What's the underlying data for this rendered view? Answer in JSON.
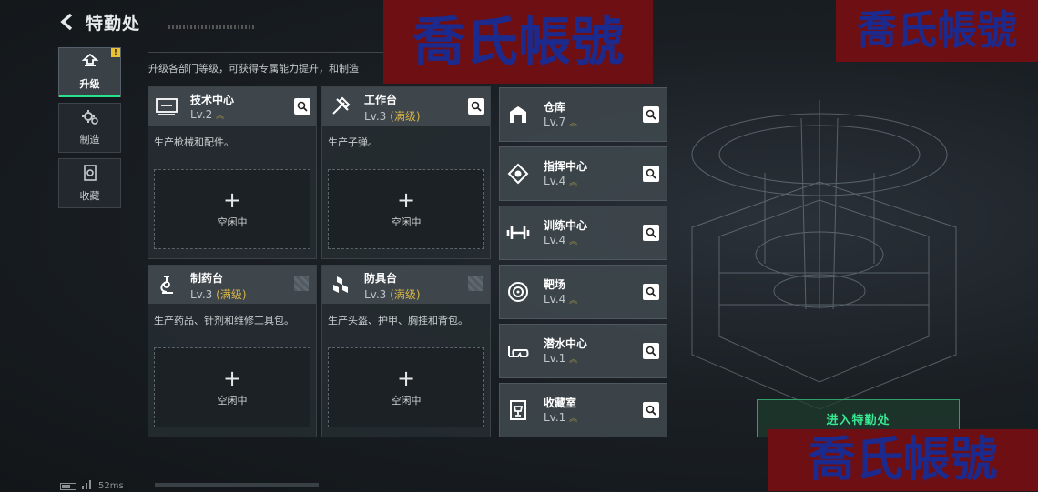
{
  "header": {
    "title": "特勤处"
  },
  "description": "升级各部门等级，可获得专属能力提升，和制造",
  "tabs": [
    {
      "label": "升级",
      "icon": "upgrade-icon",
      "active": true,
      "badge": "!"
    },
    {
      "label": "制造",
      "icon": "gear-icon",
      "active": false
    },
    {
      "label": "收藏",
      "icon": "collection-icon",
      "active": false
    }
  ],
  "cards": [
    {
      "name": "技术中心",
      "level": "Lv.2",
      "max": "",
      "desc": "生产枪械和配件。",
      "slot": "空闲中",
      "plus": "+",
      "icon": "tech-center-icon",
      "search": true
    },
    {
      "name": "工作台",
      "level": "Lv.3",
      "max": "(满级)",
      "desc": "生产子弹。",
      "slot": "空闲中",
      "plus": "+",
      "icon": "workbench-icon",
      "search": true
    },
    {
      "name": "制药台",
      "level": "Lv.3",
      "max": "(满级)",
      "desc": "生产药品、针剂和维修工具包。",
      "slot": "空闲中",
      "plus": "+",
      "icon": "pharmacy-icon",
      "search": false
    },
    {
      "name": "防具台",
      "level": "Lv.3",
      "max": "(满级)",
      "desc": "生产头盔、护甲、胸挂和背包。",
      "slot": "空闲中",
      "plus": "+",
      "icon": "armor-bench-icon",
      "search": false
    }
  ],
  "facilities": [
    {
      "name": "仓库",
      "level": "Lv.7",
      "icon": "warehouse-icon"
    },
    {
      "name": "指挥中心",
      "level": "Lv.4",
      "icon": "command-center-icon"
    },
    {
      "name": "训练中心",
      "level": "Lv.4",
      "icon": "dumbbell-icon"
    },
    {
      "name": "靶场",
      "level": "Lv.4",
      "icon": "target-icon"
    },
    {
      "name": "潜水中心",
      "level": "Lv.1",
      "icon": "diving-mask-icon"
    },
    {
      "name": "收藏室",
      "level": "Lv.1",
      "icon": "trophy-room-icon"
    }
  ],
  "enter_button": "进入特勤处",
  "watermark": "喬氏帳號",
  "status": {
    "ping": "52ms"
  },
  "colors": {
    "accent": "#27e38b",
    "max_level": "#d8b548",
    "watermark_bg": "#6e0f14",
    "watermark_text": "#1b2a8c"
  }
}
